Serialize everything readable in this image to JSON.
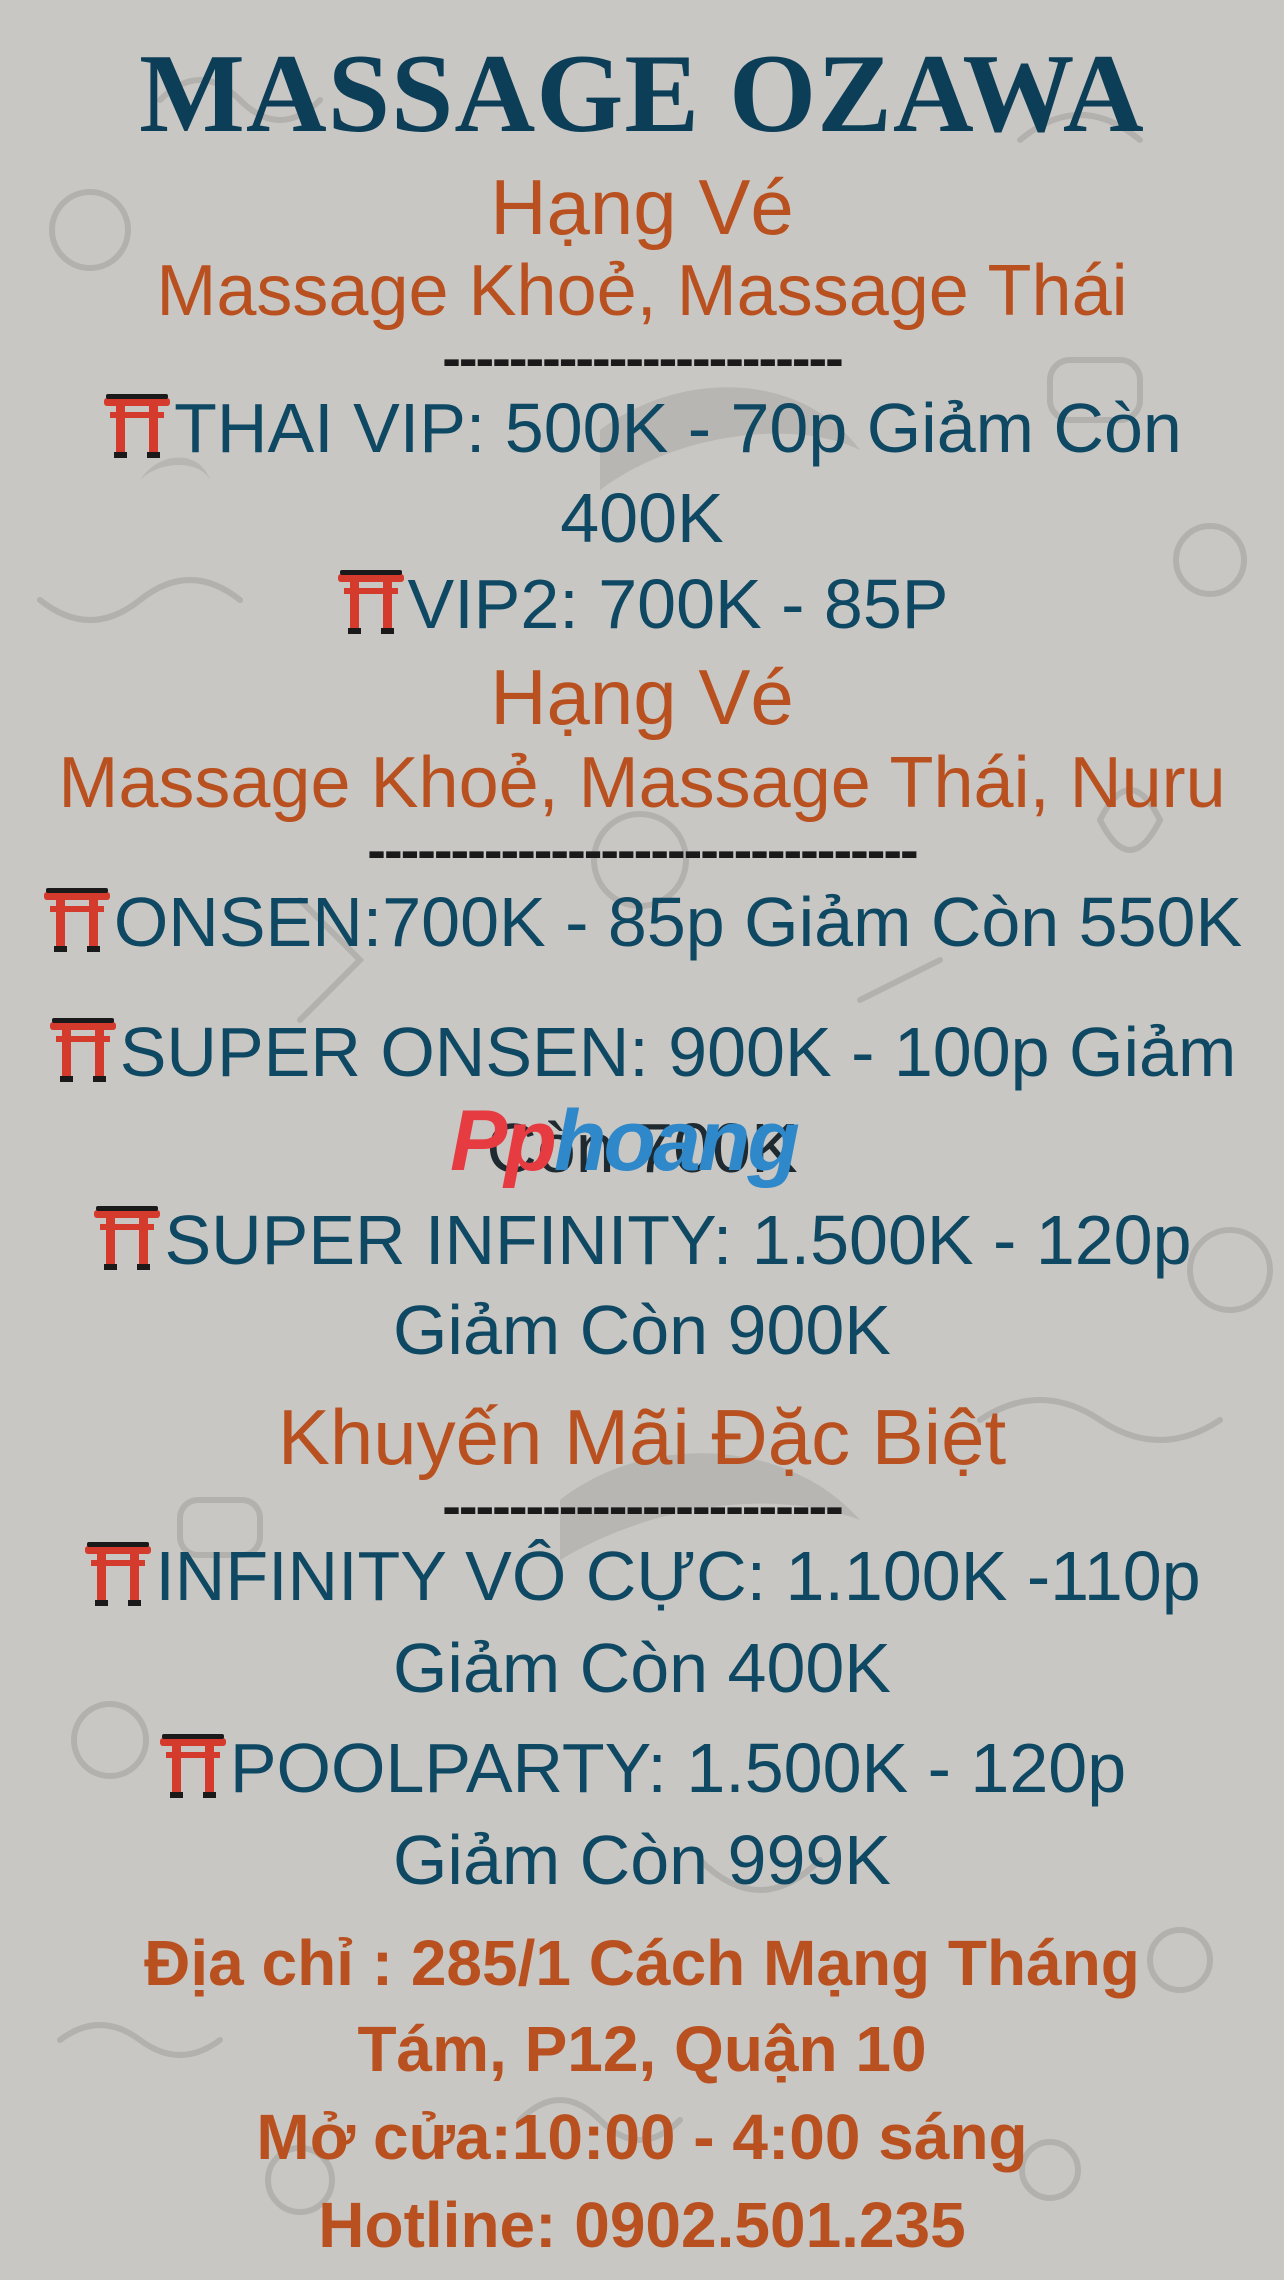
{
  "title": "MASSAGE OZAWA",
  "section1": {
    "heading": "Hạng Vé",
    "subtitle": "Massage Khoẻ, Massage Thái",
    "divider": "------------------------",
    "items": [
      {
        "line1": "THAI VIP: 500K - 70p Giảm Còn",
        "line2": "400K"
      },
      {
        "line1": "VIP2: 700K - 85P"
      }
    ]
  },
  "section2": {
    "heading": "Hạng Vé",
    "subtitle": "Massage Khoẻ, Massage Thái, Nuru",
    "divider": "---------------------------------",
    "items": [
      {
        "line1": "ONSEN:700K -  85p Giảm Còn 550K"
      },
      {
        "line1": "SUPER ONSEN: 900K - 100p Giảm",
        "line2": "Còn 700K"
      },
      {
        "line1": "SUPER INFINITY: 1.500K - 120p",
        "line2": "Giảm Còn 900K"
      }
    ]
  },
  "section3": {
    "heading": "Khuyến Mãi Đặc Biệt",
    "divider": "------------------------",
    "items": [
      {
        "line1": "INFINITY VÔ CỰC: 1.100K -110p",
        "line2": "Giảm Còn 400K"
      },
      {
        "line1": "POOLPARTY: 1.500K - 120p",
        "line2": "Giảm Còn 999K"
      }
    ]
  },
  "contact": {
    "address_line1": "Địa chỉ : 285/1 Cách Mạng Tháng",
    "address_line2": "Tám, P12, Quận 10",
    "hours": "Mở cửa:10:00 - 4:00 sáng",
    "hotline": "Hotline: 0902.501.235"
  },
  "watermark": {
    "part1": "Pp",
    "part2": "hoang"
  },
  "icons": {
    "bullet": "torii-gate-icon"
  },
  "colors": {
    "title": "#0d3e57",
    "heading": "#b9501f",
    "item": "#0f4862",
    "background": "#c9c7c4"
  }
}
